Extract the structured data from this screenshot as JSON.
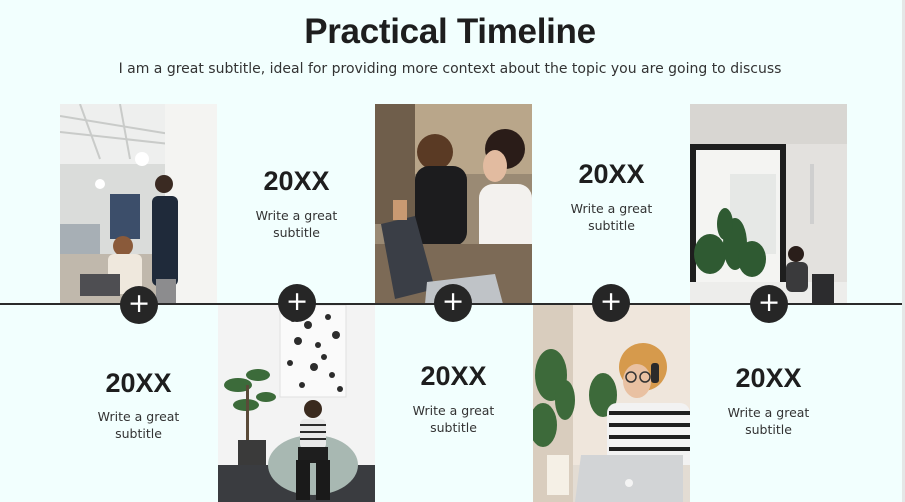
{
  "slide": {
    "title": "Practical Timeline",
    "subtitle": "I am a great subtitle, ideal for providing more context about the topic you are going to discuss"
  },
  "timeline": {
    "plus_glyph": "+",
    "items": [
      {
        "year": "20XX",
        "subtitle_line1": "Write a great",
        "subtitle_line2": "subtitle"
      },
      {
        "year": "20XX",
        "subtitle_line1": "Write a great",
        "subtitle_line2": "subtitle"
      },
      {
        "year": "20XX",
        "subtitle_line1": "Write a great",
        "subtitle_line2": "subtitle"
      },
      {
        "year": "20XX",
        "subtitle_line1": "Write a great",
        "subtitle_line2": "subtitle"
      },
      {
        "year": "20XX",
        "subtitle_line1": "Write a great",
        "subtitle_line2": "subtitle"
      }
    ]
  },
  "icons": [
    "plus-icon"
  ],
  "colors": {
    "background": "#F2FFFE",
    "text": "#1E1E1E",
    "button": "#262626",
    "line": "#2A2A2A"
  }
}
